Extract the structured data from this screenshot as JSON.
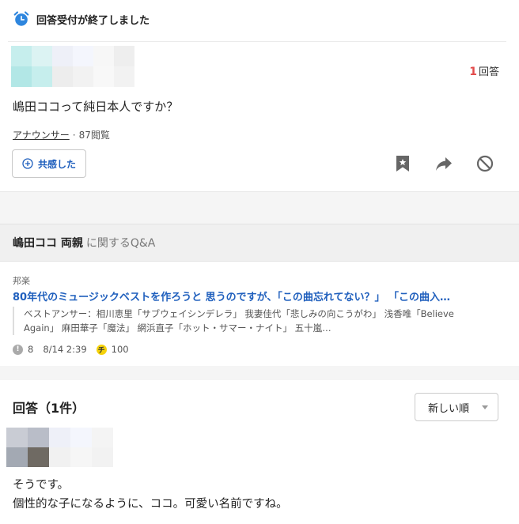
{
  "question": {
    "closed_notice": "回答受付が終了しました",
    "answer_count": "1",
    "answer_count_unit": "回答",
    "text": "嶋田ココって純日本人ですか？",
    "category": "アナウンサー",
    "separator": "·",
    "views": "87閲覧",
    "empathy_label": "共感した",
    "icons": [
      "alarm-clock-icon",
      "bookmark-icon",
      "share-icon",
      "block-icon"
    ],
    "avatar_colors": [
      "#c6eeed",
      "#dcf3f3",
      "#eef0f8",
      "#f4f6fd",
      "#f7f7f7",
      "#eeeeee",
      "#ffffff",
      "#b2e7e6",
      "#c6eeed",
      "#ededed",
      "#f2f2f2",
      "#f8f8f8",
      "#f2f2f2",
      "#ffffff"
    ]
  },
  "related": {
    "keyword": "嶋田ココ 両親",
    "suffix": "に関するQ&A",
    "category": "邦楽",
    "title": "80年代のミュージックベストを作ろうと 思うのですが、「この曲忘れてない？」 「この曲入…",
    "snippet": "ベストアンサー：相川恵里「サブウェイシンデレラ」 我妻佳代「悲しみの向こうがわ」 浅香唯「Believe Again」 麻田華子「魔法」 網浜直子「ホット・サマー・ナイト」 五十嵐…",
    "answers": "8",
    "date": "8/14 2:39",
    "coin_symbol": "チ",
    "coins": "100"
  },
  "answers": {
    "title": "回答（1件）",
    "sort_label": "新しい順",
    "body_line1": "そうです。",
    "body_line2": "個性的な子になるように、ココ。可愛い名前ですね。",
    "avatar_colors": [
      "#c9ccd4",
      "#b9bdc8",
      "#eef0f8",
      "#f4f6fd",
      "#f4f4f4",
      "#ffffff",
      "#a3a9b3",
      "#6f6a63",
      "#f1f1f1",
      "#f6f6f6",
      "#f2f2f2",
      "#ffffff"
    ]
  },
  "colors": {
    "link_blue": "#1f5fbd",
    "accent_red": "#e24b4b",
    "clock_blue": "#2e86de"
  }
}
